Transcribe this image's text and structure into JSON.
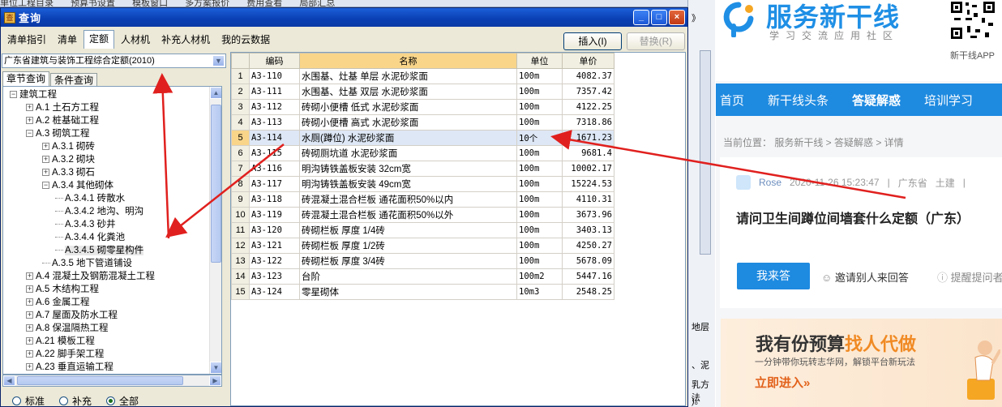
{
  "bg_toolbar": {
    "items": [
      "单位工程目录",
      "预算书设置",
      "模板窗口",
      "多方案报价",
      "费用查看",
      "局部汇总"
    ]
  },
  "bg_right": {
    "texts": [
      "》",
      "地层",
      "、泥",
      "乳方法",
      ")。"
    ]
  },
  "dialog": {
    "title": "查询",
    "window_buttons": {
      "minimize": "_",
      "maximize": "□",
      "close": "×"
    },
    "tabs": [
      "清单指引",
      "清单",
      "定额",
      "人材机",
      "补充人材机",
      "我的云数据"
    ],
    "active_tab": "定额",
    "insert_button": "插入(I)",
    "replace_button": "替换(R)",
    "quota_dropdown": "广东省建筑与装饰工程综合定额(2010)",
    "sub_tabs": [
      "章节查询",
      "条件查询"
    ],
    "tree": [
      {
        "label": "建筑工程",
        "toggle": "−"
      },
      {
        "label": "A.1 土石方工程",
        "toggle": "+"
      },
      {
        "label": "A.2 桩基础工程",
        "toggle": "+"
      },
      {
        "label": "A.3 砌筑工程",
        "toggle": "−"
      },
      {
        "label": "A.3.1 砌砖",
        "toggle": "+"
      },
      {
        "label": "A.3.2 砌块",
        "toggle": "+"
      },
      {
        "label": "A.3.3 砌石",
        "toggle": "+"
      },
      {
        "label": "A.3.4 其他砌体",
        "toggle": "−"
      },
      {
        "label": "A.3.4.1 砖散水",
        "toggle": ""
      },
      {
        "label": "A.3.4.2 地沟、明沟",
        "toggle": ""
      },
      {
        "label": "A.3.4.3 砂井",
        "toggle": ""
      },
      {
        "label": "A.3.4.4 化粪池",
        "toggle": ""
      },
      {
        "label": "A.3.4.5 砌零星构件",
        "toggle": ""
      },
      {
        "label": "A.3.5 地下管道铺设",
        "toggle": ""
      },
      {
        "label": "A.4 混凝土及钢筋混凝土工程",
        "toggle": "+"
      },
      {
        "label": "A.5 木结构工程",
        "toggle": "+"
      },
      {
        "label": "A.6 金属工程",
        "toggle": "+"
      },
      {
        "label": "A.7 屋面及防水工程",
        "toggle": "+"
      },
      {
        "label": "A.8 保温隔热工程",
        "toggle": "+"
      },
      {
        "label": "A.21 模板工程",
        "toggle": "+"
      },
      {
        "label": "A.22 脚手架工程",
        "toggle": "+"
      },
      {
        "label": "A.23 垂直运输工程",
        "toggle": "+"
      }
    ],
    "scroll_glyphs": {
      "up": "▲",
      "down": "▼",
      "left": "◀",
      "right": "▶",
      "dropdown": "▼"
    },
    "radios": [
      {
        "label": "标准",
        "checked": false
      },
      {
        "label": "补充",
        "checked": false
      },
      {
        "label": "全部",
        "checked": true
      }
    ],
    "grid": {
      "headers": [
        "",
        "编码",
        "名称",
        "单位",
        "单价"
      ],
      "rows": [
        [
          "1",
          "A3-110",
          "水围基、灶基 单层 水泥砂浆面",
          "100m",
          "4082.37"
        ],
        [
          "2",
          "A3-111",
          "水围基、灶基 双层 水泥砂浆面",
          "100m",
          "7357.42"
        ],
        [
          "3",
          "A3-112",
          "砖砌小便槽 低式 水泥砂浆面",
          "100m",
          "4122.25"
        ],
        [
          "4",
          "A3-113",
          "砖砌小便槽 高式 水泥砂浆面",
          "100m",
          "7318.86"
        ],
        [
          "5",
          "A3-114",
          "水厕(蹲位) 水泥砂浆面",
          "10个",
          "1671.23"
        ],
        [
          "6",
          "A3-115",
          "砖砌厕坑道 水泥砂浆面",
          "100m",
          "9681.4"
        ],
        [
          "7",
          "A3-116",
          "明沟铸铁盖板安装 32cm宽",
          "100m",
          "10002.17"
        ],
        [
          "8",
          "A3-117",
          "明沟铸铁盖板安装 49cm宽",
          "100m",
          "15224.53"
        ],
        [
          "9",
          "A3-118",
          "砖混凝土混合栏板 通花面积50%以内",
          "100m",
          "4110.31"
        ],
        [
          "10",
          "A3-119",
          "砖混凝土混合栏板 通花面积50%以外",
          "100m",
          "3673.96"
        ],
        [
          "11",
          "A3-120",
          "砖砌栏板 厚度 1/4砖",
          "100m",
          "3403.13"
        ],
        [
          "12",
          "A3-121",
          "砖砌栏板 厚度 1/2砖",
          "100m",
          "4250.27"
        ],
        [
          "13",
          "A3-122",
          "砖砌栏板 厚度 3/4砖",
          "100m",
          "5678.09"
        ],
        [
          "14",
          "A3-123",
          "台阶",
          "100m2",
          "5447.16"
        ],
        [
          "15",
          "A3-124",
          "零星砌体",
          "10m3",
          "2548.25"
        ]
      ],
      "selected_row": 5
    }
  },
  "web": {
    "logo": "服务新干线",
    "logo_sub": "学习交流应用社区",
    "qr_label": "新干线APP",
    "nav": [
      "首页",
      "新干线头条",
      "答疑解惑",
      "培训学习"
    ],
    "active_nav": "答疑解惑",
    "breadcrumb": "当前位置： 服务新干线 > 答疑解惑 > 详情",
    "author": "Rose",
    "time": "2020-11-26 15:23:47",
    "region": "广东省",
    "category": "土建",
    "separator": "|",
    "question": "请问卫生间蹲位间墙套什么定额（广东）",
    "answer_button": "我来答",
    "invite": "邀请别人来回答",
    "remind": "提醒提问者",
    "banner_title_a": "我有份预算",
    "banner_title_b": "找人代做",
    "banner_sub": "一分钟带你玩转志华网，解锁平台新玩法",
    "banner_cta": "立即进入»"
  },
  "colors": {
    "accent": "#1e8ae0",
    "arrow": "#e0201e",
    "titlebar": "#0a3fb3",
    "banner_accent": "#f08a24"
  }
}
